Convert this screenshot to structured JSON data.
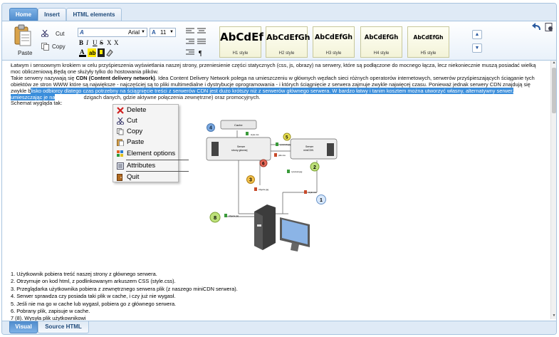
{
  "tabs": [
    "Home",
    "Insert",
    "HTML elements"
  ],
  "ribbon": {
    "paste": "Paste",
    "cut": "Cut",
    "copy": "Copy",
    "font_name": "Arial",
    "font_size": "11",
    "styles": [
      {
        "sample": "AbCdEf",
        "caption": "H1 style"
      },
      {
        "sample": "AbCdEfGh",
        "caption": "H2 style"
      },
      {
        "sample": "AbCdEfGh",
        "caption": "H3 style"
      },
      {
        "sample": "AbCdEfGh",
        "caption": "H4 style"
      },
      {
        "sample": "AbCdEfGh",
        "caption": "H5 style"
      }
    ],
    "bold": "B",
    "italic": "I",
    "underline": "U",
    "strike": "S",
    "subscript": "X",
    "superscript": "X"
  },
  "content": {
    "p1": "Łatwym i sensownym krokiem w celu przyśpieszenia wyświetlania naszej strony, przeniesienie części statycznych (css, js, obrazy) na serwery, które są podłączone do mocnego łącza, lecz niekoniecznie muszą posiadać wielką moc obliczeniową.Będą one służyły tylko do hostowania plików.",
    "p2_pre": "Takie serwery nazywają się ",
    "p2_bold": "CDN (Content delivery network)",
    "p2_post": ". Idea Content Delivery Network polega na umieszczeniu w głównych węzłach sieci różnych operatorów internetowych, serwerów przyśpieszających ściąganie tych obiektów ze stron WWW które są największe - najczęściej są to pliki multimedialne i dystrybucje oprogramowania - i których ściągnięcie z serwera zajmuje zwykle najwięcej czasu. Ponieważ jednak serwery CDN znajdują się zwykle b",
    "p2_sel": "lisko odbiorcy dlatego czas potrzebny na ściągnięcie treści z serwerów CDN jest dużo krótszy niż z serwerów głównego serwera. W bardzo łatwy i tanim kosztem można utworzyć własny, alternatywny serwer, umieszczając je na",
    "p2_tail": "dzigach danych, gdzie aktywne połączenia zewnętrzne) oraz promocyjnych.",
    "p3": "Schemat wygląda tak:"
  },
  "context_menu": [
    "Delete",
    "Cut",
    "Copy",
    "Paste",
    "Element options",
    "Attributes",
    "Quit"
  ],
  "diagram": {
    "cache": "Cache",
    "main_server": "Serwer\nstrony głównej",
    "mini_server": "Serwer\nminiCDN",
    "labels": [
      "style.css",
      "rysunek.jpg",
      "plik.css",
      "rysunek.jpg",
      "zdjęcie.jpg",
      "style.css",
      "zdjęcie.jpg"
    ],
    "numbers": [
      "1",
      "2",
      "3",
      "4",
      "5",
      "6",
      "8"
    ]
  },
  "steps": [
    "1. Użytkownik pobiera treść naszej strony z głównego serwera.",
    "2. Otrzymuje on kod html, z podlinkowanym arkuszem CSS (style.css).",
    "3. Przeglądarka użytkownika pobiera z zewnętrznego serwera plik (z naszego miniCDN serwera).",
    "4. Serwer sprawdza czy posiada taki plik w cache, i czy już nie wygasł.",
    "5. Jeśli nie ma go w cache lub wygasł, pobiera go z głównego serwera.",
    "6. Pobrany plik, zapisuje w cache.",
    "7 (8). Wysyła plik użytkownikowi"
  ],
  "bottom_tabs": [
    "Visual",
    "Source HTML"
  ]
}
